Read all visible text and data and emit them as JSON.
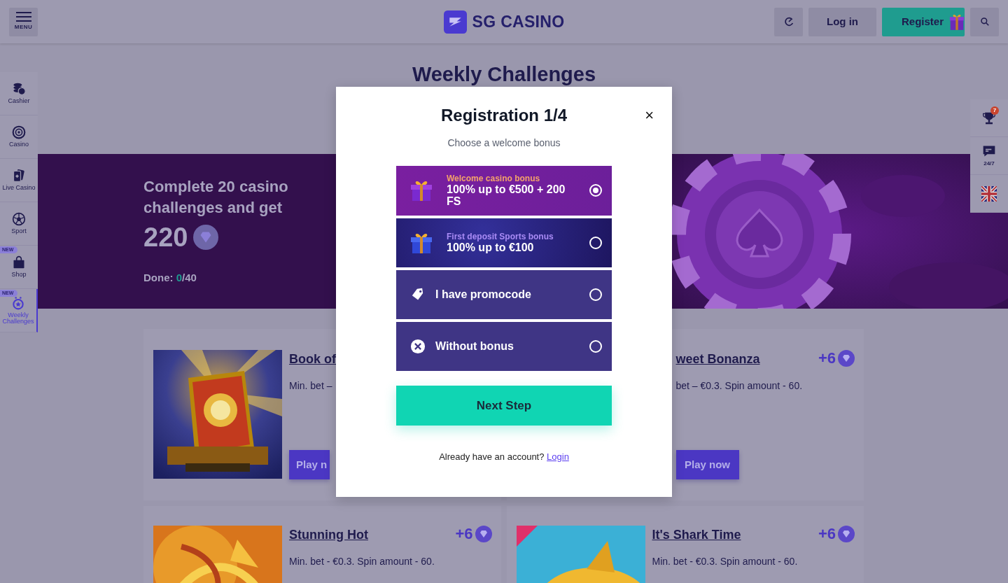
{
  "header": {
    "menu_label": "MENU",
    "logo": "SG CASINO",
    "login": "Log in",
    "register": "Register"
  },
  "sidebar": {
    "items": [
      {
        "label": "Cashier",
        "selected": false
      },
      {
        "label": "Casino",
        "selected": false
      },
      {
        "label": "Live Casino",
        "selected": false
      },
      {
        "label": "Sport",
        "selected": false
      },
      {
        "label": "Shop",
        "badge": "NEW",
        "selected": false
      },
      {
        "label": "Weekly Challenges",
        "badge": "NEW",
        "selected": true
      }
    ]
  },
  "page_title": "Weekly Challenges",
  "banner": {
    "headline": "Complete 20 casino challenges and get",
    "amount": "220",
    "done": {
      "label": "Done:",
      "count": "0",
      "total": "/40"
    }
  },
  "right_rail": {
    "trophy_badge": "7",
    "chat_label": "24/7"
  },
  "challenges": [
    {
      "title": "Book of",
      "description": "Min. bet –",
      "button": "Play n"
    },
    {
      "title": "weet Bonanza",
      "reward": "+6",
      "description": "bet – €0.3. Spin amount - 60.",
      "button": "Play now"
    },
    {
      "title": "Stunning Hot",
      "reward": "+6",
      "description": "Min. bet - €0.3. Spin amount - 60."
    },
    {
      "title": "It's Shark Time",
      "reward": "+6",
      "description": "Min. bet - €0.3. Spin amount - 60."
    }
  ],
  "modal": {
    "title": "Registration 1/4",
    "close": "×",
    "subtitle": "Choose a welcome bonus",
    "options": [
      {
        "kind": "casino",
        "subtitle": "Welcome casino bonus",
        "label": "100% up to €500 + 200 FS",
        "selected": true
      },
      {
        "kind": "sports",
        "subtitle": "First deposit Sports bonus",
        "label": "100% up to €100",
        "selected": false
      },
      {
        "kind": "promocode",
        "label": "I have promocode",
        "selected": false
      },
      {
        "kind": "none",
        "label": "Without bonus",
        "selected": false
      }
    ],
    "next_button": "Next Step",
    "footer_text": "Already have an account?",
    "footer_link": "Login"
  }
}
